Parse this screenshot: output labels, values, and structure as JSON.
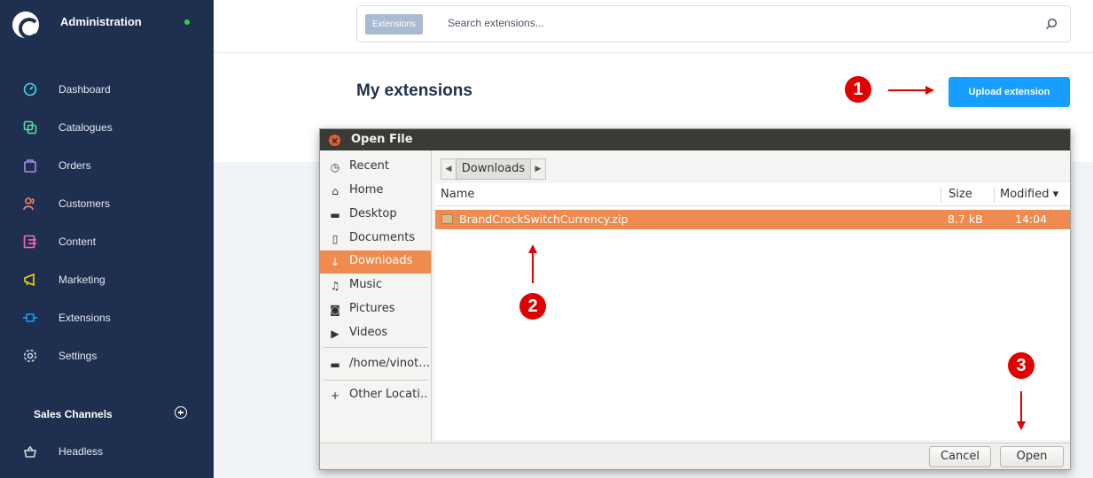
{
  "sidebar": {
    "title": "Administration",
    "items": [
      {
        "label": "Dashboard",
        "icon": "dashboard-icon",
        "color": "#48d7ee"
      },
      {
        "label": "Catalogues",
        "icon": "catalogues-icon",
        "color": "#57d9a3"
      },
      {
        "label": "Orders",
        "icon": "orders-icon",
        "color": "#a092f0"
      },
      {
        "label": "Customers",
        "icon": "customers-icon",
        "color": "#f88962"
      },
      {
        "label": "Content",
        "icon": "content-icon",
        "color": "#ff68b4"
      },
      {
        "label": "Marketing",
        "icon": "marketing-icon",
        "color": "#ffd700"
      },
      {
        "label": "Extensions",
        "icon": "extensions-icon",
        "color": "#189eff"
      },
      {
        "label": "Settings",
        "icon": "settings-icon",
        "color": "#d1d9e0"
      }
    ],
    "section_title": "Sales Channels",
    "channels": [
      {
        "label": "Headless",
        "icon": "basket-icon"
      }
    ]
  },
  "search": {
    "tag": "Extensions",
    "placeholder": "Search extensions..."
  },
  "page": {
    "title": "My extensions",
    "upload_label": "Upload extension"
  },
  "annotations": {
    "one": "1",
    "two": "2",
    "three": "3"
  },
  "dialog": {
    "title": "Open File",
    "places": [
      {
        "label": "Recent",
        "icon": "clock-icon"
      },
      {
        "label": "Home",
        "icon": "home-icon"
      },
      {
        "label": "Desktop",
        "icon": "folder-icon"
      },
      {
        "label": "Documents",
        "icon": "document-icon"
      },
      {
        "label": "Downloads",
        "icon": "download-icon"
      },
      {
        "label": "Music",
        "icon": "music-icon"
      },
      {
        "label": "Pictures",
        "icon": "camera-icon"
      },
      {
        "label": "Videos",
        "icon": "video-icon"
      },
      {
        "label": "/home/vinot…",
        "icon": "folder-icon"
      },
      {
        "label": "Other Locati…",
        "icon": "plus-icon"
      }
    ],
    "path": "Downloads",
    "columns": {
      "name": "Name",
      "size": "Size",
      "modified": "Modified ▾"
    },
    "files": [
      {
        "name": "BrandCrockSwitchCurrency.zip",
        "size": "8.7 kB",
        "modified": "14:04"
      }
    ],
    "cancel_label": "Cancel",
    "open_label": "Open"
  }
}
